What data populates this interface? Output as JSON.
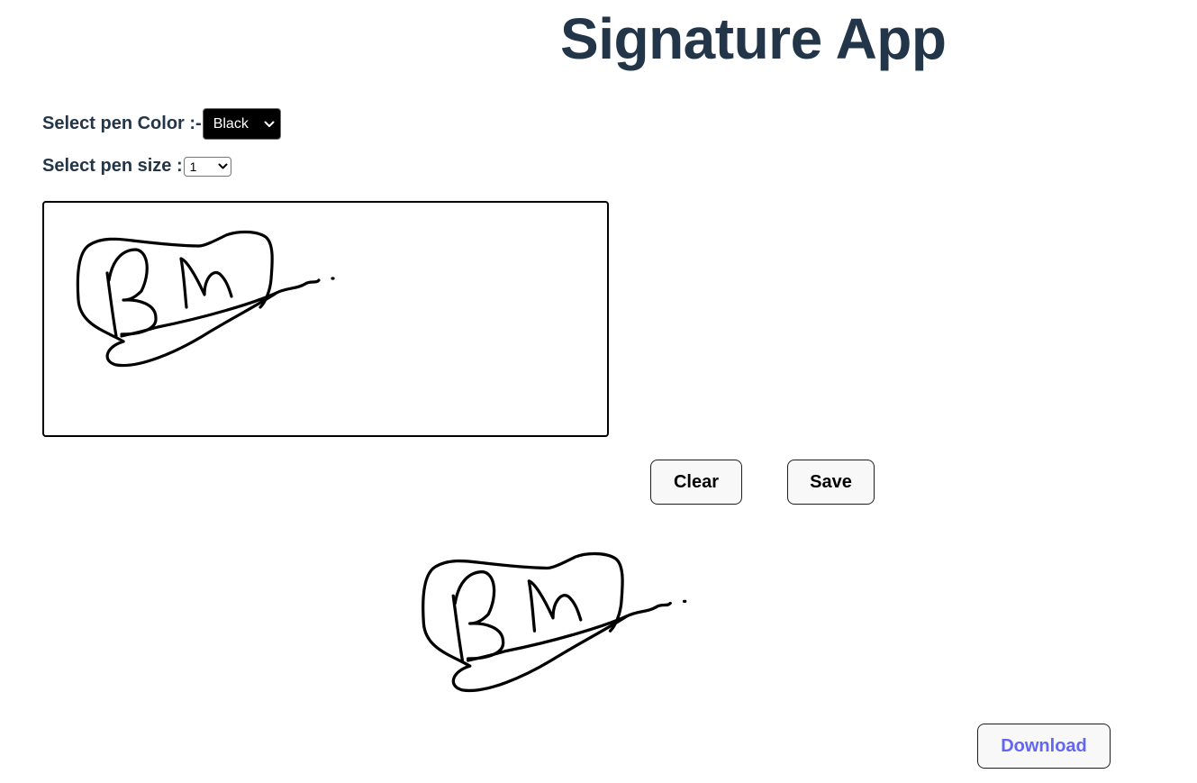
{
  "app": {
    "title": "Signature App"
  },
  "controls": {
    "pen_color_label": "Select pen Color :-",
    "pen_color_value": "Black",
    "pen_color_bg": "#000000",
    "pen_size_label": "Select pen size :",
    "pen_size_value": "1"
  },
  "actions": {
    "clear_label": "Clear",
    "save_label": "Save",
    "download_label": "Download"
  },
  "colors": {
    "heading": "#233548",
    "download_text": "#6366f1",
    "stroke": "#000000"
  },
  "icons": {
    "select_arrow": "chevron-down-icon"
  }
}
